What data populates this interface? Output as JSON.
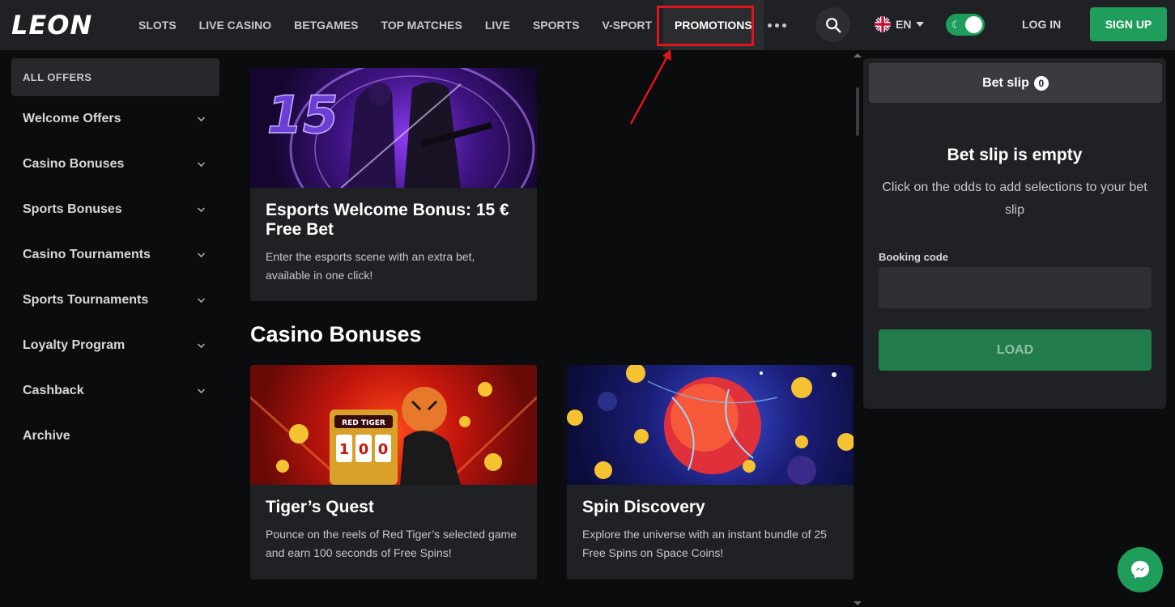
{
  "header": {
    "logo": "LEON",
    "nav": [
      "SLOTS",
      "LIVE CASINO",
      "BETGAMES",
      "TOP MATCHES",
      "LIVE",
      "SPORTS",
      "V-SPORT",
      "PROMOTIONS"
    ],
    "active_nav": "PROMOTIONS",
    "language": "EN",
    "login": "LOG IN",
    "signup": "SIGN UP",
    "icons": [
      "more-dots-icon",
      "search-icon",
      "uk-flag-icon",
      "moon-icon",
      "caret-down-icon"
    ]
  },
  "sidebar": {
    "all_offers": "ALL OFFERS",
    "items": [
      {
        "label": "Welcome Offers",
        "expandable": true
      },
      {
        "label": "Casino Bonuses",
        "expandable": true
      },
      {
        "label": "Sports Bonuses",
        "expandable": true
      },
      {
        "label": "Casino Tournaments",
        "expandable": true
      },
      {
        "label": "Sports Tournaments",
        "expandable": true
      },
      {
        "label": "Loyalty Program",
        "expandable": true
      },
      {
        "label": "Cashback",
        "expandable": true
      },
      {
        "label": "Archive",
        "expandable": false
      }
    ]
  },
  "main": {
    "cards": [
      {
        "title": "Esports Welcome Bonus: 15 € Free Bet",
        "desc": "Enter the esports scene with an extra bet, available in one click!",
        "image_label": "15"
      },
      {
        "title": "Tiger’s Quest",
        "desc": "Pounce on the reels of Red Tiger’s selected game and earn 100 seconds of Free Spins!",
        "image_label": "RED TIGER"
      },
      {
        "title": "Spin Discovery",
        "desc": "Explore the universe with an instant bundle of 25 Free Spins on Space Coins!"
      }
    ],
    "section_casino": "Casino Bonuses"
  },
  "betslip": {
    "tab_label": "Bet slip",
    "count": "0",
    "empty_title": "Bet slip is empty",
    "empty_desc": "Click on the odds to add selections to your bet slip",
    "booking_label": "Booking code",
    "booking_value": "",
    "load": "LOAD"
  },
  "colors": {
    "accent_green": "#1f9d5b",
    "highlight_red": "#e0141b",
    "panel": "#1f2124",
    "background": "#0b0c0e"
  }
}
